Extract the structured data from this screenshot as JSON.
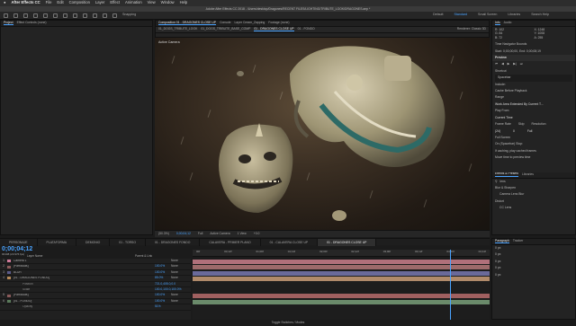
{
  "menubar": {
    "apple": "",
    "app": "After Effects CC",
    "items": [
      "File",
      "Edit",
      "Composition",
      "Layer",
      "Effect",
      "Animation",
      "View",
      "Window",
      "Help"
    ]
  },
  "titlebar": {
    "text": "Adobe After Effects CC 2018 - /Users/desktop/Dragones/RECENT FILES/LIGHTING/TRIBUTE_LOOK/DRAGONES.aep *"
  },
  "toolbar": {
    "snapping": "Snapping",
    "workspaces": [
      "Default",
      "Standard",
      "Small Screen",
      "Libraries"
    ],
    "active_ws": "Standard",
    "search": "Search Help"
  },
  "project": {
    "tab": "Project",
    "effects_tab": "Effect Controls (none)"
  },
  "viewer_tabs": [
    "Composition 01 - DRAGONES CLOSE UP",
    "Console",
    "Layer Cream_Zapping",
    "Footage (none)"
  ],
  "breadcrumbs": [
    "01_DOGS_TRIBUTE_LOOK",
    "01_DOGS_TRIBUTE_BASE_COMP",
    "01 - DRAGONES CLOSE UP",
    "01 - FONDO"
  ],
  "renderer": "Renderer: Classic 3D",
  "viewer": {
    "label": "Active Camera",
    "zoom": "(50.3%)",
    "time": "0;00;04;12",
    "res": "Full",
    "view": "Active Camera",
    "views": "1 View",
    "exposure": "+0.0"
  },
  "right_panel": {
    "info": "Info",
    "audio": "Audio",
    "coords": [
      "R: 102",
      "X: 1248",
      "G: 84",
      "Y: 1008",
      "B: 72",
      "A: 255"
    ],
    "tnb": "Time Navigator Bounds",
    "tnb_val": "Start: 0;00;00;00, End: 0;00;08;19",
    "preview": "Preview",
    "shortcut": "Shortcut",
    "spacebar": "Spacebar",
    "include": "Include:",
    "cache": "Cache Before Playback",
    "range": "Range",
    "range_val": "Work Area Extended By Current T...",
    "play_from": "Play From",
    "current_time": "Current Time",
    "frame_rate": "Frame Rate",
    "skip": "Skip",
    "resolution": "Resolution",
    "fr_val": "(24)",
    "skip_val": "0",
    "res_val": "Full",
    "full_screen": "Full Screen",
    "on_stop": "On (Spacebar) Stop:",
    "if_caching": "If caching, play cached frames",
    "move_time": "Move time to preview time",
    "effects": "Effects & Presets",
    "libraries": "Libraries",
    "search_q": "lens",
    "blur": "Blur & Sharpen",
    "camera_lens": "Camera Lens Blur",
    "distort": "Distort",
    "cc_lens": "CC Lens"
  },
  "timeline": {
    "tabs": [
      "PERSONAJE",
      "PLATAFORMA",
      "DEMONIO",
      "01 - TORSO",
      "01 - DRAGONES FONDO",
      "CALAVERA - PRIMER PLANO",
      "01 - CALAVERA CLOSE UP",
      "01 - DRAGONES CLOSE UP"
    ],
    "active_tab": "01 - DRAGONES CLOSE UP",
    "timecode": "0;00;04;12",
    "fps": "00108 (23.976 fps)",
    "col_layer": "Layer Name",
    "col_parent": "Parent & Link",
    "ruler": [
      "00f",
      "00;12f",
      "01;00f",
      "01;12f",
      "02;00f",
      "02;12f",
      "03;00f",
      "03;12f",
      "04;00f",
      "04;12f"
    ],
    "layers": [
      {
        "n": "1",
        "name": "Camera 1",
        "mode": "None",
        "pct": "",
        "color": "#d07a9a"
      },
      {
        "n": "2",
        "name": "[Partículas]",
        "mode": "None",
        "pct": "100.0%",
        "color": "#8a5a5a"
      },
      {
        "n": "3",
        "name": "BLUR",
        "mode": "None",
        "pct": "100.0%",
        "color": "#5a5a8a"
      },
      {
        "n": "4",
        "name": "[01 - DRAGONES FONDO]",
        "mode": "None",
        "pct": "85.0%",
        "color": "#b68a5a"
      },
      {
        "n": "",
        "name": "Position",
        "mode": "",
        "pct": "721.0,405.0,0.0",
        "color": ""
      },
      {
        "n": "",
        "name": "Scale",
        "mode": "",
        "pct": "100.0,100.0,100.0%",
        "color": ""
      },
      {
        "n": "5",
        "name": "[Partículas]",
        "mode": "None",
        "pct": "100.0%",
        "color": "#8a5a5a"
      },
      {
        "n": "6",
        "name": "[01 - FONDO]",
        "mode": "None",
        "pct": "100.0%",
        "color": "#5a7a5a"
      },
      {
        "n": "",
        "name": "Opacity",
        "mode": "",
        "pct": "51%",
        "color": ""
      }
    ],
    "bar_colors": [
      "#b0707a",
      "#9c6a6a",
      "#6a6a9a",
      "#b08a6a",
      "",
      "",
      "#a06060",
      "#6a8a6a",
      ""
    ],
    "toggle": "Toggle Switches / Modes"
  },
  "paragraph": {
    "tab": "Paragraph",
    "tracker": "Tracker",
    "vals": [
      "0 px",
      "0 px",
      "0 px",
      "0 px",
      "0 px"
    ]
  }
}
